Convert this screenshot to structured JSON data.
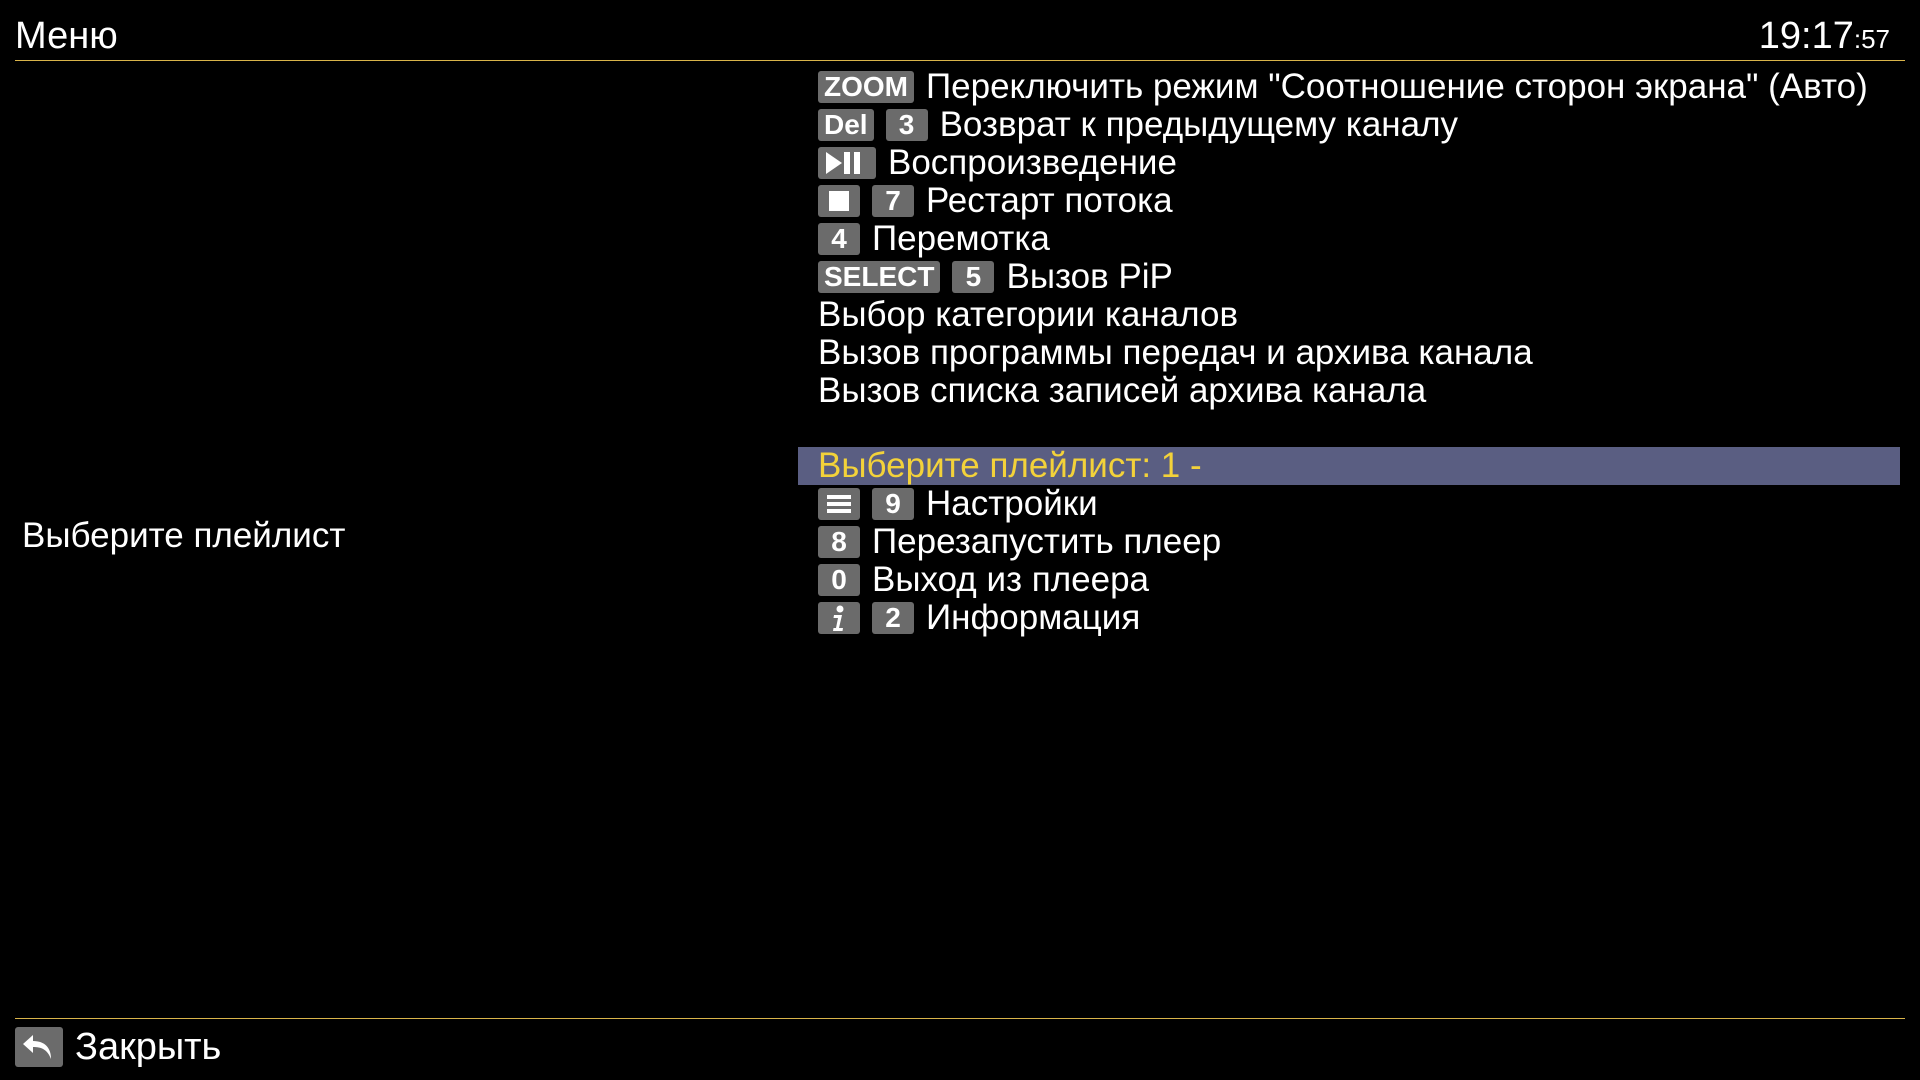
{
  "header": {
    "title": "Меню",
    "clock_hm": "19:17",
    "clock_sec": ":57"
  },
  "left": {
    "label": "Выберите плейлист"
  },
  "menu": {
    "items": [
      {
        "keys": [
          "ZOOM"
        ],
        "label": "Переключить режим \"Соотношение сторон экрана\" (Авто)"
      },
      {
        "keys": [
          "Del",
          "3"
        ],
        "label": "Возврат к предыдущему каналу"
      },
      {
        "keys": [
          "play-pause-icon"
        ],
        "label": "Воспроизведение"
      },
      {
        "keys": [
          "stop-icon",
          "7"
        ],
        "label": "Рестарт потока"
      },
      {
        "keys": [
          "4"
        ],
        "label": "Перемотка"
      },
      {
        "keys": [
          "SELECT",
          "5"
        ],
        "label": "Вызов PiP"
      },
      {
        "keys": [],
        "label": "Выбор категории каналов"
      },
      {
        "keys": [],
        "label": "Вызов программы передач и архива канала"
      },
      {
        "keys": [],
        "label": "Вызов списка записей архива канала"
      },
      {
        "keys": [],
        "label": "Выберите плейлист: 1 -",
        "selected": true
      },
      {
        "keys": [
          "menu-icon",
          "9"
        ],
        "label": "Настройки"
      },
      {
        "keys": [
          "8"
        ],
        "label": "Перезапустить плеер"
      },
      {
        "keys": [
          "0"
        ],
        "label": "Выход из плеера"
      },
      {
        "keys": [
          "info-icon",
          "2"
        ],
        "label": "Информация"
      }
    ]
  },
  "footer": {
    "back_icon": "back-arrow-icon",
    "close_label": "Закрыть"
  },
  "colors": {
    "background": "#000000",
    "divider": "#d9b44a",
    "selected_bg": "#5a5e82",
    "selected_text": "#f3d23a",
    "key_bg": "#6b6b6b"
  }
}
